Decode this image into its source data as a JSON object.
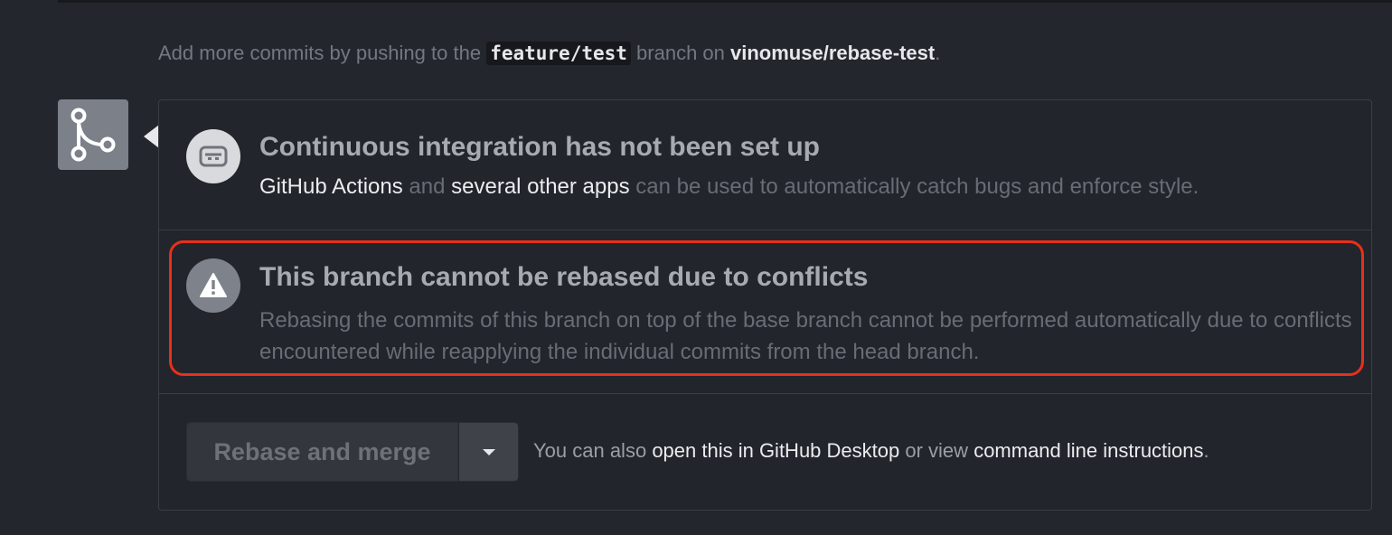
{
  "push_hint": {
    "prefix": "Add more commits by pushing to the",
    "branch": "feature/test",
    "middle": "branch on",
    "repo": "vinomuse/rebase-test",
    "suffix": "."
  },
  "ci": {
    "title": "Continuous integration has not been set up",
    "link1": "GitHub Actions",
    "and": "and",
    "link2": "several other apps",
    "rest": "can be used to automatically catch bugs and enforce style."
  },
  "conflict": {
    "title": "This branch cannot be rebased due to conflicts",
    "description": "Rebasing the commits of this branch on top of the base branch cannot be performed automatically due to conflicts encountered while reapplying the individual commits from the head branch."
  },
  "merge": {
    "button_label": "Rebase and merge",
    "hint_prefix": "You can also",
    "desktop_link": "open this in GitHub Desktop",
    "hint_or": "or view",
    "cli_link": "command line instructions",
    "hint_suffix": "."
  },
  "icons": {
    "merge": "git-merge-icon",
    "ci": "robot-icon",
    "warning": "alert-icon",
    "dropdown": "caret-down-icon"
  },
  "colors": {
    "highlight": "#e8301a",
    "background": "#23262d"
  }
}
